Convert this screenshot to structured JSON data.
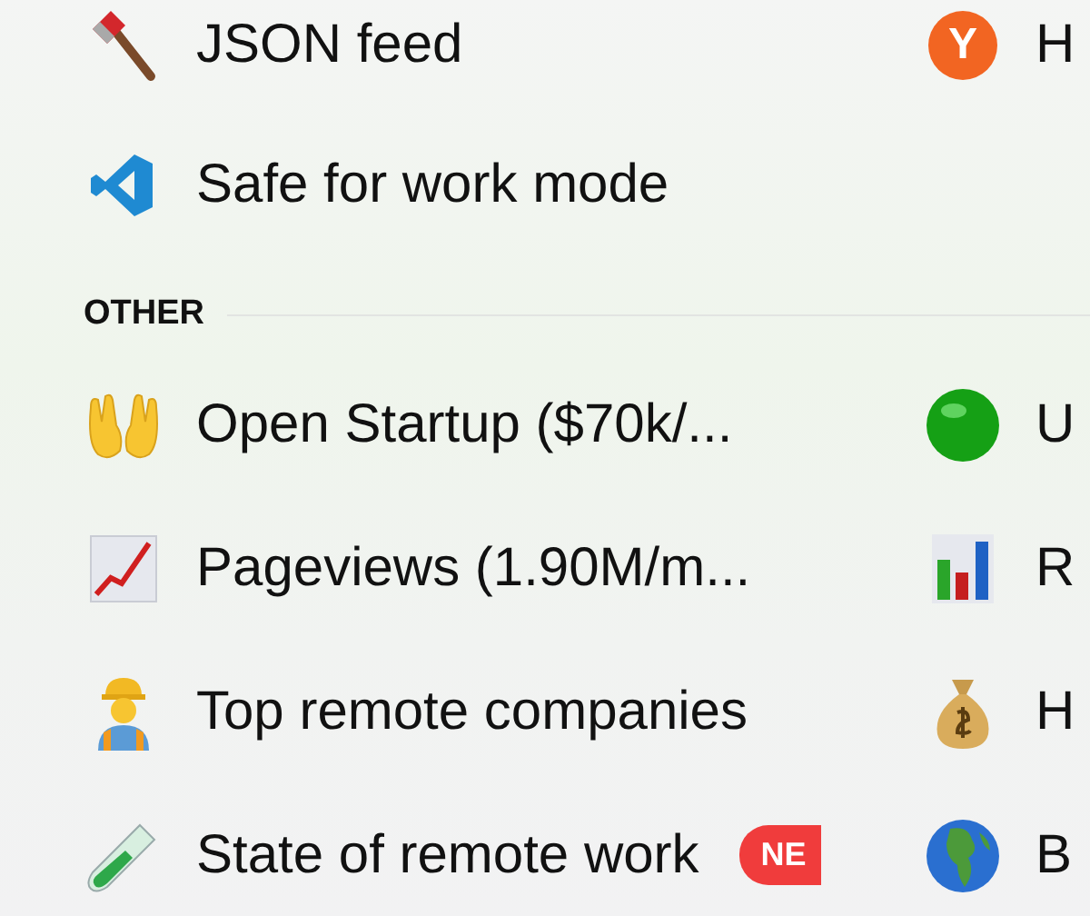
{
  "sections": [
    {
      "rows": [
        {
          "left": {
            "label": "JSON feed"
          },
          "right": {
            "label": "H",
            "icon_text": "Y"
          }
        },
        {
          "left": {
            "label": "Safe for work mode"
          }
        }
      ]
    },
    {
      "heading": "OTHER",
      "rows": [
        {
          "left": {
            "label": "Open Startup ($70k/..."
          },
          "right": {
            "label": "U"
          }
        },
        {
          "left": {
            "label": "Pageviews (1.90M/m..."
          },
          "right": {
            "label": "R"
          }
        },
        {
          "left": {
            "label": "Top remote companies"
          },
          "right": {
            "label": "H"
          }
        },
        {
          "left": {
            "label": "State of remote work",
            "badge": "NE"
          },
          "right": {
            "label": "B"
          }
        }
      ]
    }
  ]
}
